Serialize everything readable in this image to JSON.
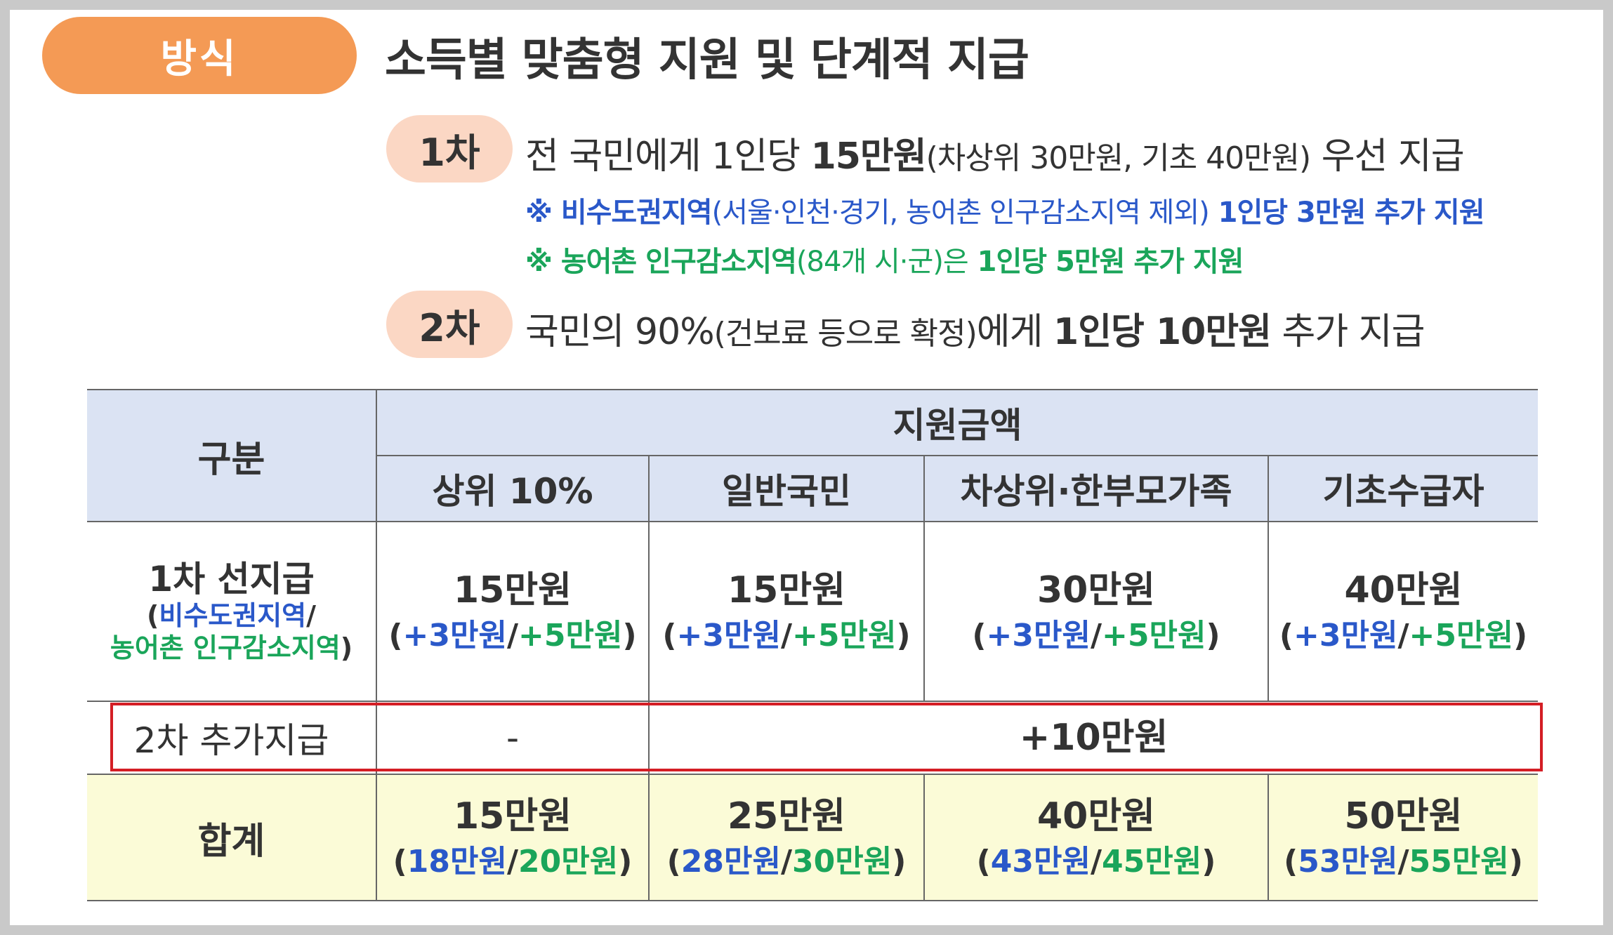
{
  "method_label": "방식",
  "headline": "소득별 맞춤형 지원 및 단계적 지급",
  "stage1": {
    "label": "1차",
    "text_a": "전 국민에게 1인당 ",
    "text_b": "15만원",
    "text_c": "(차상위 30만원, 기초 40만원)",
    "text_d": " 우선 지급",
    "note1_a": "※ 비수도권지역",
    "note1_b": "(서울·인천·경기, 농어촌 인구감소지역 제외)",
    "note1_c": " 1인당 3만원 추가 지원",
    "note2_a": "※ 농어촌 인구감소지역",
    "note2_b": "(84개 시·군)은",
    "note2_c": " 1인당 5만원 추가 지원"
  },
  "stage2": {
    "label": "2차",
    "text_a": "국민의 90%",
    "text_b": "(건보료 등으로 확정)",
    "text_c": "에게 ",
    "text_d": "1인당 10만원",
    "text_e": " 추가 지급"
  },
  "table": {
    "col_gubun": "구분",
    "col_group": "지원금액",
    "columns": [
      "상위 10%",
      "일반국민",
      "차상위·한부모가족",
      "기초수급자"
    ],
    "row1": {
      "label": "1차 선지급",
      "sub_open": "(",
      "sub_blue": "비수도권지역",
      "sub_slash": "/",
      "sub_green": "농어촌 인구감소지역",
      "sub_close": ")",
      "cells": [
        {
          "main": "15만원",
          "blue": "+3만원",
          "green": "+5만원"
        },
        {
          "main": "15만원",
          "blue": "+3만원",
          "green": "+5만원"
        },
        {
          "main": "30만원",
          "blue": "+3만원",
          "green": "+5만원"
        },
        {
          "main": "40만원",
          "blue": "+3만원",
          "green": "+5만원"
        }
      ]
    },
    "row2": {
      "label": "2차 추가지급",
      "first": "-",
      "rest": "+10만원"
    },
    "total": {
      "label": "합계",
      "cells": [
        {
          "main": "15만원",
          "blue": "18만원",
          "green": "20만원"
        },
        {
          "main": "25만원",
          "blue": "28만원",
          "green": "30만원"
        },
        {
          "main": "40만원",
          "blue": "43만원",
          "green": "45만원"
        },
        {
          "main": "50만원",
          "blue": "53만원",
          "green": "55만원"
        }
      ]
    }
  },
  "colors": {
    "orange_pill": "#f49a55",
    "stage_pill": "#fbd7c4",
    "blue": "#2a58c9",
    "green": "#1aa55a",
    "highlight_border": "#d41e25",
    "header_bg": "#dbe3f3",
    "total_bg": "#fbfbd7"
  }
}
